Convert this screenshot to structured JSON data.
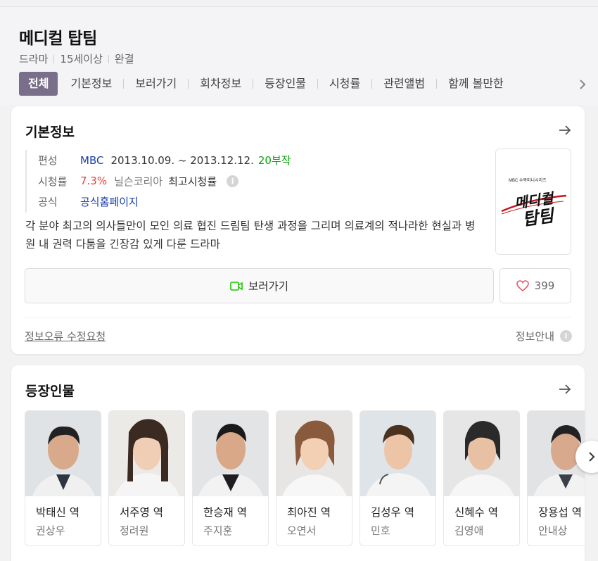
{
  "header": {
    "title": "메디컬 탑팀",
    "meta": [
      "드라마",
      "15세이상",
      "완결"
    ],
    "tabs": [
      {
        "label": "전체",
        "active": true
      },
      {
        "label": "기본정보"
      },
      {
        "label": "보러가기"
      },
      {
        "label": "회차정보"
      },
      {
        "label": "등장인물"
      },
      {
        "label": "시청률"
      },
      {
        "label": "관련앨범"
      },
      {
        "label": "함께 볼만한"
      }
    ]
  },
  "basic_info": {
    "title": "기본정보",
    "rows": {
      "broadcast": {
        "label": "편성",
        "channel": "MBC",
        "period": "2013.10.09. ~ 2013.12.12.",
        "episodes": "20부작"
      },
      "rating": {
        "label": "시청률",
        "value": "7.3%",
        "source": "닐슨코리아",
        "note": "최고시청률"
      },
      "official": {
        "label": "공식",
        "link": "공식홈페이지"
      }
    },
    "description": "각 분야 최고의 의사들만이 모인 의료 협진 드림팀 탄생 과정을 그리며 의료계의 적나라한 현실과 병원 내 권력 다툼을 긴장감 있게 다룬 드라마",
    "watch_button": "보러가기",
    "like_count": "399",
    "report_link": "정보오류 수정요청",
    "info_guide": "정보안내",
    "colors": {
      "link_blue": "#1a3ea8",
      "episodes_green": "#0aa30a",
      "rating_red": "#e04040",
      "tab_active": "#7a6f8a"
    }
  },
  "cast": {
    "title": "등장인물",
    "members": [
      {
        "role": "박태신 역",
        "actor": "권상우"
      },
      {
        "role": "서주영 역",
        "actor": "정려원"
      },
      {
        "role": "한승재 역",
        "actor": "주지훈"
      },
      {
        "role": "최아진 역",
        "actor": "오연서"
      },
      {
        "role": "김성우 역",
        "actor": "민호"
      },
      {
        "role": "신혜수 역",
        "actor": "김영애"
      },
      {
        "role": "장용섭 역",
        "actor": "안내상"
      }
    ]
  }
}
